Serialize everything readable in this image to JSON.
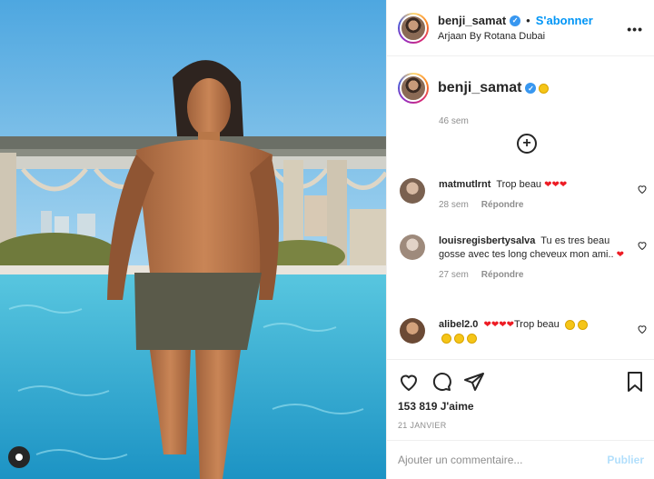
{
  "post": {
    "username": "benji_samat",
    "verified_icon": "verified-badge-icon",
    "follow_label": "S'abonner",
    "location": "Arjaan By Rotana Dubai",
    "more_icon": "more-options-icon",
    "caption_time": "46 sem",
    "load_more_icon": "plus-circle-icon"
  },
  "comments": [
    {
      "user": "matmutlrnt",
      "text": "Trop beau",
      "hearts": "❤❤❤",
      "time": "28 sem",
      "reply": "Répondre"
    },
    {
      "user": "louisregisbertysalva",
      "text": "Tu es tres beau gosse avec tes long cheveux mon ami..",
      "hearts": "❤",
      "time": "27 sem",
      "reply": "Répondre"
    },
    {
      "user": "alibel2.0",
      "text": "Trop beau",
      "hearts": "❤❤❤❤",
      "time": "",
      "reply": ""
    }
  ],
  "actions": {
    "like_icon": "heart-icon",
    "comment_icon": "comment-icon",
    "share_icon": "paper-plane-icon",
    "save_icon": "bookmark-icon",
    "likes_count": "153 819 J'aime",
    "date": "21 JANVIER"
  },
  "composer": {
    "placeholder": "Ajouter un commentaire...",
    "publish_label": "Publier"
  },
  "colors": {
    "accent": "#0095f6",
    "heart": "#ed1c24",
    "muted": "#8e8e8e",
    "publish_disabled": "#b2dffc"
  }
}
